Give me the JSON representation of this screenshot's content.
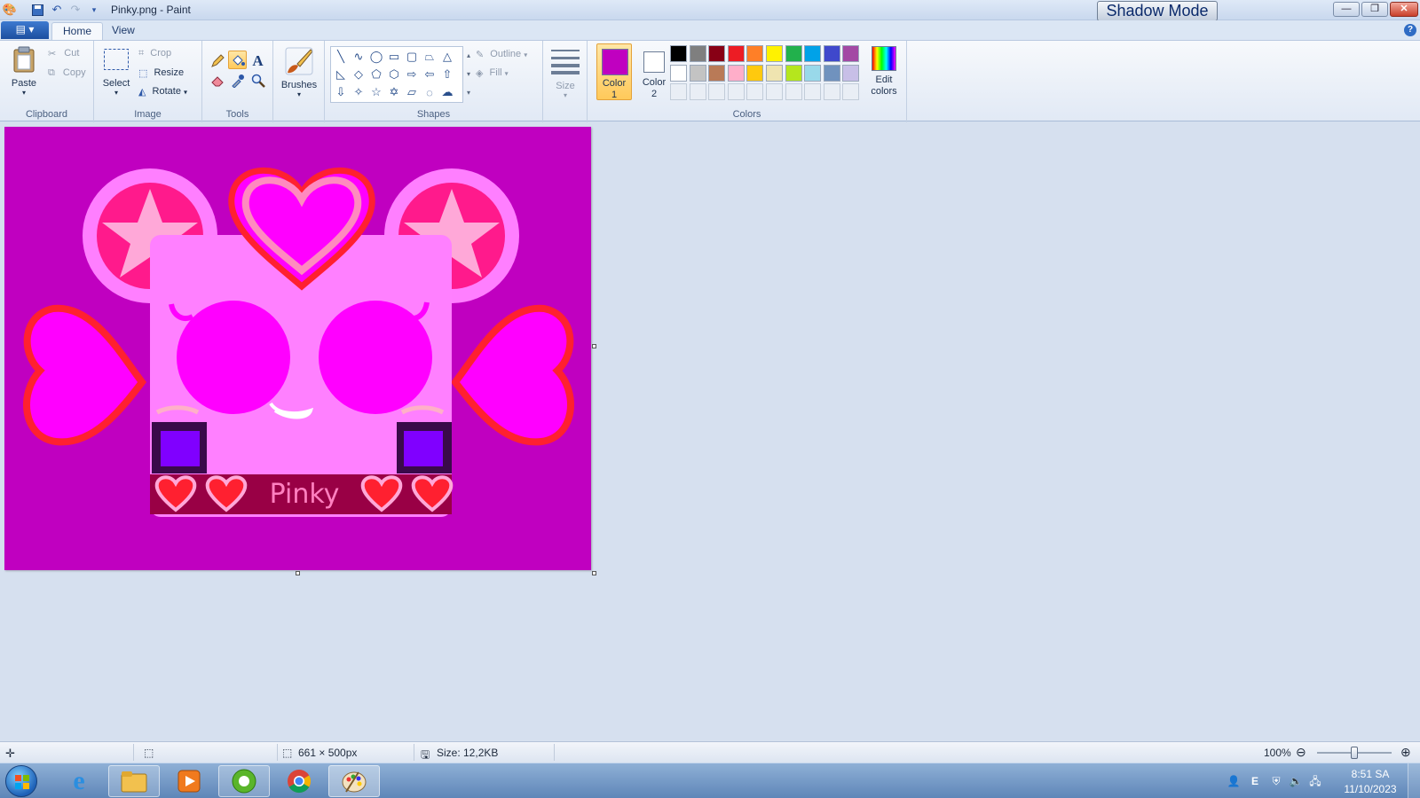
{
  "window": {
    "title": "Pinky.png - Paint",
    "overlay_button": "Shadow Mode",
    "minimize_glyph": "—",
    "restore_glyph": "❐",
    "close_glyph": "✕"
  },
  "tabs": {
    "file_glyph": "▤ ▾",
    "home": "Home",
    "view": "View",
    "help_glyph": "?"
  },
  "ribbon": {
    "clipboard": {
      "label": "Clipboard",
      "paste": "Paste",
      "cut": "Cut",
      "copy": "Copy"
    },
    "image": {
      "label": "Image",
      "select": "Select",
      "crop": "Crop",
      "resize": "Resize",
      "rotate": "Rotate"
    },
    "tools": {
      "label": "Tools"
    },
    "brushes": {
      "label": "Brushes"
    },
    "shapes": {
      "label": "Shapes",
      "outline": "Outline",
      "fill": "Fill"
    },
    "size": {
      "label": "Size"
    },
    "colors": {
      "label": "Colors",
      "color1_line1": "Color",
      "color1_line2": "1",
      "color2_line1": "Color",
      "color2_line2": "2",
      "edit_line1": "Edit",
      "edit_line2": "colors",
      "color1_value": "#c000c0",
      "color2_value": "#ffffff",
      "palette_row1": [
        "#000000",
        "#7f7f7f",
        "#880015",
        "#ed1c24",
        "#ff7f27",
        "#fff200",
        "#22b14c",
        "#00a2e8",
        "#3f48cc",
        "#a349a4"
      ],
      "palette_row2": [
        "#ffffff",
        "#c3c3c3",
        "#b97a57",
        "#ffaec9",
        "#ffc90e",
        "#efe4b0",
        "#b5e61d",
        "#99d9ea",
        "#7092be",
        "#c8bfe7"
      ]
    }
  },
  "canvas": {
    "image_text": "Pinky",
    "background": "#c000c0"
  },
  "status": {
    "dimensions": "661 × 500px",
    "size": "Size: 12,2KB",
    "zoom": "100%",
    "zoom_fraction": 0.5
  },
  "taskbar": {
    "apps": [
      "internet-explorer",
      "file-explorer",
      "media-player",
      "browser-alt",
      "chrome",
      "paint"
    ],
    "time": "8:51 SA",
    "date": "11/10/2023"
  }
}
